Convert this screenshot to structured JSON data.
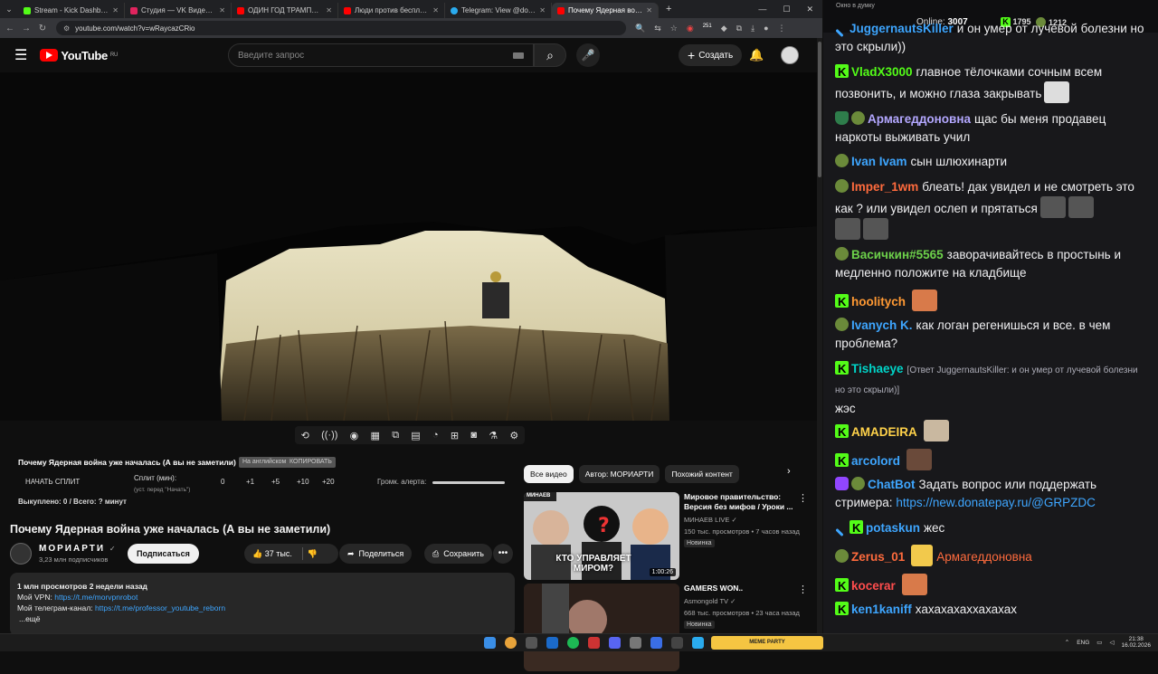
{
  "browser": {
    "tabs": [
      {
        "title": "Stream - Kick Dashboard",
        "color": "#53fc18"
      },
      {
        "title": "Студия — VK Видео Live",
        "color": "#e0245e"
      },
      {
        "title": "ОДИН ГОД ТРАМПА - YouTube",
        "color": "#ff0000"
      },
      {
        "title": "Люди против бесплодия: сем...",
        "color": "#ff0000"
      },
      {
        "title": "Telegram: View @dobro_2ch",
        "color": "#2aabee"
      },
      {
        "title": "Почему Ядерная война у...",
        "color": "#ff0000"
      }
    ],
    "new_tab": "+",
    "url": "youtube.com/watch?v=wRaycazCRio",
    "ext_count": "251"
  },
  "youtube": {
    "logo_text": "YouTube",
    "logo_region": "RU",
    "search_placeholder": "Введите запрос",
    "create_label": "Создать",
    "ext": {
      "title": "Почему Ядерная война уже началась (А вы не заметили)",
      "chip1": "На английском",
      "chip2": "КОПИРОВАТЬ",
      "start_split": "НАЧАТЬ СПЛИТ",
      "split_label": "Сплит (мин):",
      "split_hint": "(уст. перед \"Начать\")",
      "split_value": "0",
      "incs": [
        "+1",
        "+5",
        "+10",
        "+20"
      ],
      "alert_label": "Громк. алерта:",
      "paid": "Выкуплено: 0 / Всего: ? минут"
    },
    "video_title": "Почему Ядерная война уже началась (А вы не заметили)",
    "channel": {
      "name": "МОРИАРТИ",
      "subs": "3,23 млн подписчиков",
      "subscribe": "Подписаться"
    },
    "actions": {
      "likes": "37 тыс.",
      "share": "Поделиться",
      "save": "Сохранить",
      "more": "•••"
    },
    "description": {
      "stats": "1 млн просмотров  2 недели назад",
      "vpn_label": "Мой VPN:",
      "vpn_link": "https://t.me/morvpnrobot",
      "tg_label": "Мой телеграм-канал:",
      "tg_link": "https://t.me/professor_youtube_reborn",
      "more": "...ещё"
    },
    "rec_chips": [
      "Все видео",
      "Автор: МОРИАРТИ",
      "Похожий контент"
    ],
    "recs": [
      {
        "title": "Мировое правительство: Версия без мифов / Уроки ...",
        "channel": "МИНАЕВ LIVE",
        "meta": "150 тыс. просмотров • 7 часов назад",
        "badge": "Новинка",
        "duration": "1:00:26",
        "thumb_caption": "КТО УПРАВЛЯЕТ МИРОМ?",
        "thumb_tag": "МИНАЕВ"
      },
      {
        "title": "GAMERS WON..",
        "channel": "Asmongold TV",
        "meta": "668 тыс. просмотров • 23 часа назад",
        "badge": "Новинка"
      }
    ]
  },
  "chat": {
    "window_title": "Окно в думку",
    "online_label": "Online:",
    "online_value": "3007",
    "stat2": "1795",
    "stat3": "1212",
    "messages": [
      {
        "user": "JuggernautsKiller",
        "color": "#3ea6ff",
        "text": "и он умер от лучевой болезни но это скрыли))"
      },
      {
        "user": "VladX3000",
        "color": "#53fc18",
        "text": "главное тёлочками сочным всем позвонить, и можно глаза закрывать"
      },
      {
        "user": "Армагеддоновна",
        "color": "#b3a7ff",
        "text": "щас бы меня продавец наркоты выживать учил"
      },
      {
        "user": "Ivan Ivam",
        "color": "#3ea6ff",
        "text": "сын шлюхинарти"
      },
      {
        "user": "Imper_1wm",
        "color": "#ff6b3d",
        "text": "блеать! дак увидел и не смотреть это как ? или увидел ослеп и прятаться"
      },
      {
        "user": "Васичкин#5565",
        "color": "#6dd14a",
        "text": "заворачивайтесь в простынь и медленно положите на кладбище"
      },
      {
        "user": "hoolitych",
        "color": "#ff9933",
        "text": ""
      },
      {
        "user": "Ivanych K.",
        "color": "#3ea6ff",
        "text": "как логан регенишься и все. в чем проблема?"
      },
      {
        "user": "Tishaeye",
        "color": "#00d4c8",
        "reply": "[Ответ JuggernautsKiller: и он умер от лучевой болезни но это скрыли)]",
        "text": "жэс"
      },
      {
        "user": "AMADEIRA",
        "color": "#ffd24a",
        "text": ""
      },
      {
        "user": "arcolord",
        "color": "#3ea6ff",
        "text": ""
      },
      {
        "user": "ChatBot",
        "color": "#3ea6ff",
        "text": "Задать вопрос или поддержать стримера:",
        "link": "https://new.donatepay.ru/@GRPZDC"
      },
      {
        "user": "potaskun",
        "color": "#3ea6ff",
        "text": "жес"
      },
      {
        "user": "Zerus_01",
        "color": "#ff6b3d",
        "text": "Армагеддоновна"
      },
      {
        "user": "kocerar",
        "color": "#ff4d4d",
        "text": ""
      },
      {
        "user": "ken1kaniff",
        "color": "#3ea6ff",
        "text": "хахахахаххахахах"
      }
    ]
  },
  "taskbar": {
    "widget": "MEME PARTY",
    "lang": "ENG",
    "time": "21:38",
    "date": "16.02.2026"
  }
}
